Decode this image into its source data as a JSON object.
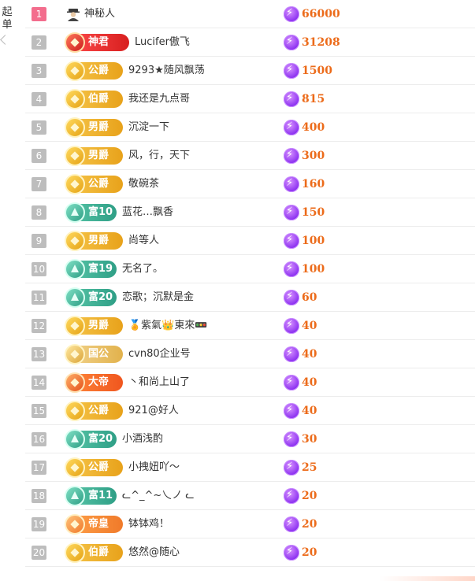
{
  "sidebar": {
    "tab_chars": [
      "起",
      "单"
    ]
  },
  "colors": {
    "accent_score": "#ec6b1a",
    "rank_first": "#f36d8d",
    "rank_default": "#bdbdbd"
  },
  "rows": [
    {
      "rank": "1",
      "badge": "",
      "badge_style": "none",
      "name": "神秘人",
      "score": "66000",
      "icon": "mystery-man-icon"
    },
    {
      "rank": "2",
      "badge": "神君",
      "badge_style": "red",
      "name": "Lucifer傲飞",
      "score": "31208"
    },
    {
      "rank": "3",
      "badge": "公爵",
      "badge_style": "gold",
      "name": "9293★随风飘荡",
      "score": "1500"
    },
    {
      "rank": "4",
      "badge": "伯爵",
      "badge_style": "gold",
      "name": "我还是九点哥",
      "score": "815"
    },
    {
      "rank": "5",
      "badge": "男爵",
      "badge_style": "gold",
      "name": "沉淀一下",
      "score": "400"
    },
    {
      "rank": "6",
      "badge": "男爵",
      "badge_style": "gold",
      "name": "风，行，天下",
      "score": "300"
    },
    {
      "rank": "7",
      "badge": "公爵",
      "badge_style": "gold",
      "name": "敬碗茶",
      "score": "160"
    },
    {
      "rank": "8",
      "badge": "富10",
      "badge_style": "teal",
      "name": "蓝花…飘香",
      "score": "150"
    },
    {
      "rank": "9",
      "badge": "男爵",
      "badge_style": "gold",
      "name": "尚等人",
      "score": "100"
    },
    {
      "rank": "10",
      "badge": "富19",
      "badge_style": "teal",
      "name": "无名了。",
      "score": "100"
    },
    {
      "rank": "11",
      "badge": "富20",
      "badge_style": "teal",
      "name": "恋歌；沉默是金",
      "score": "60"
    },
    {
      "rank": "12",
      "badge": "男爵",
      "badge_style": "gold",
      "name": "🏅紫氣👑東來🚥",
      "score": "40"
    },
    {
      "rank": "13",
      "badge": "国公",
      "badge_style": "cream",
      "name": "cvn80企业号",
      "score": "40"
    },
    {
      "rank": "14",
      "badge": "大帝",
      "badge_style": "orange",
      "name": "丶和尚上山了",
      "score": "40"
    },
    {
      "rank": "15",
      "badge": "公爵",
      "badge_style": "gold",
      "name": "921@好人",
      "score": "40"
    },
    {
      "rank": "16",
      "badge": "富20",
      "badge_style": "teal",
      "name": "小酒浅酌",
      "score": "30"
    },
    {
      "rank": "17",
      "badge": "公爵",
      "badge_style": "gold",
      "name": "小拽妞吖～",
      "score": "25"
    },
    {
      "rank": "18",
      "badge": "富11",
      "badge_style": "teal",
      "name": "ᓚ^_^~乀ノ ᓚ",
      "score": "20"
    },
    {
      "rank": "19",
      "badge": "帝皇",
      "badge_style": "orange2",
      "name": "钵钵鸡！",
      "score": "20"
    },
    {
      "rank": "20",
      "badge": "伯爵",
      "badge_style": "gold",
      "name": "悠然@随心",
      "score": "20"
    }
  ]
}
